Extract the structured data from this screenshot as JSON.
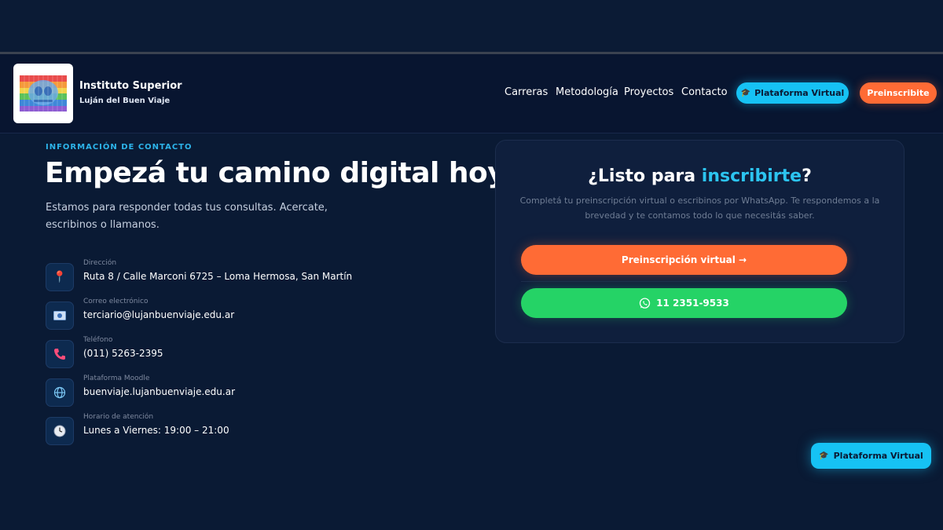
{
  "brand": {
    "name": "Instituto Superior",
    "subtitle": "Luján del Buen Viaje"
  },
  "nav": {
    "items": [
      "Carreras",
      "Metodología",
      "Proyectos",
      "Contacto"
    ],
    "platform_label": "Plataforma Virtual",
    "enroll_label": "Preinscribite"
  },
  "contact": {
    "eyebrow": "INFORMACIÓN DE CONTACTO",
    "headline": "Empezá tu camino digital hoy",
    "lead": "Estamos para responder todas tus consultas. Acercate, escribinos o llamanos.",
    "items": [
      {
        "icon": "pin-icon",
        "label": "Dirección",
        "value": "Ruta 8 / Calle Marconi 6725 – Loma Hermosa, San Martín"
      },
      {
        "icon": "mail-icon",
        "label": "Correo electrónico",
        "value": "terciario@lujanbuenviaje.edu.ar"
      },
      {
        "icon": "phone-icon",
        "label": "Teléfono",
        "value": "(011) 5263-2395"
      },
      {
        "icon": "globe-icon",
        "label": "Plataforma Moodle",
        "value": "buenviaje.lujanbuenviaje.edu.ar"
      },
      {
        "icon": "clock-icon",
        "label": "Horario de atención",
        "value": "Lunes a Viernes: 19:00 – 21:00"
      }
    ]
  },
  "card": {
    "title_prefix": "¿Listo para ",
    "title_highlight": "inscribirte",
    "title_suffix": "?",
    "text": "Completá tu preinscripción virtual o escribinos por WhatsApp. Te respondemos a la brevedad y te contamos todo lo que necesitás saber.",
    "primary_button": "Preinscripción virtual →",
    "whatsapp_button": "11 2351-9533"
  },
  "floating": {
    "platform_label": "Plataforma Virtual"
  },
  "colors": {
    "background": "#0a1a34",
    "accent_blue": "#16c2f4",
    "accent_orange": "#ff6b35",
    "whatsapp_green": "#25d366"
  }
}
